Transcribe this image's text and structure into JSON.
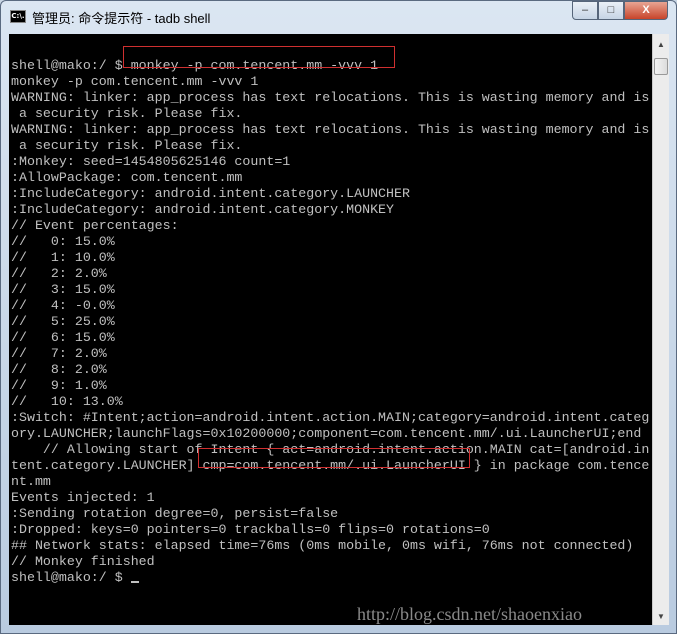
{
  "window": {
    "title": "管理员: 命令提示符 - tadb  shell",
    "icon": "cmd-icon",
    "icon_text": "C:\\.",
    "buttons": {
      "minimize": "–",
      "maximize": "□",
      "close": "X"
    }
  },
  "console": {
    "lines": [
      "shell@mako:/ $ monkey -p com.tencent.mm -vvv 1",
      "monkey -p com.tencent.mm -vvv 1",
      "WARNING: linker: app_process has text relocations. This is wasting memory and is",
      " a security risk. Please fix.",
      "WARNING: linker: app_process has text relocations. This is wasting memory and is",
      " a security risk. Please fix.",
      ":Monkey: seed=1454805625146 count=1",
      ":AllowPackage: com.tencent.mm",
      ":IncludeCategory: android.intent.category.LAUNCHER",
      ":IncludeCategory: android.intent.category.MONKEY",
      "// Event percentages:",
      "//   0: 15.0%",
      "//   1: 10.0%",
      "//   2: 2.0%",
      "//   3: 15.0%",
      "//   4: -0.0%",
      "//   5: 25.0%",
      "//   6: 15.0%",
      "//   7: 2.0%",
      "//   8: 2.0%",
      "//   9: 1.0%",
      "//   10: 13.0%",
      ":Switch: #Intent;action=android.intent.action.MAIN;category=android.intent.categ",
      "ory.LAUNCHER;launchFlags=0x10200000;component=com.tencent.mm/.ui.LauncherUI;end",
      "    // Allowing start of Intent { act=android.intent.action.MAIN cat=[android.in",
      "tent.category.LAUNCHER] cmp=com.tencent.mm/.ui.LauncherUI } in package com.tence",
      "nt.mm",
      "Events injected: 1",
      ":Sending rotation degree=0, persist=false",
      ":Dropped: keys=0 pointers=0 trackballs=0 flips=0 rotations=0",
      "## Network stats: elapsed time=76ms (0ms mobile, 0ms wifi, 76ms not connected)",
      "// Monkey finished"
    ],
    "prompt": "shell@mako:/ $ ",
    "highlight_color": "#d03030"
  },
  "watermark": "http://blog.csdn.net/shaoenxiao"
}
